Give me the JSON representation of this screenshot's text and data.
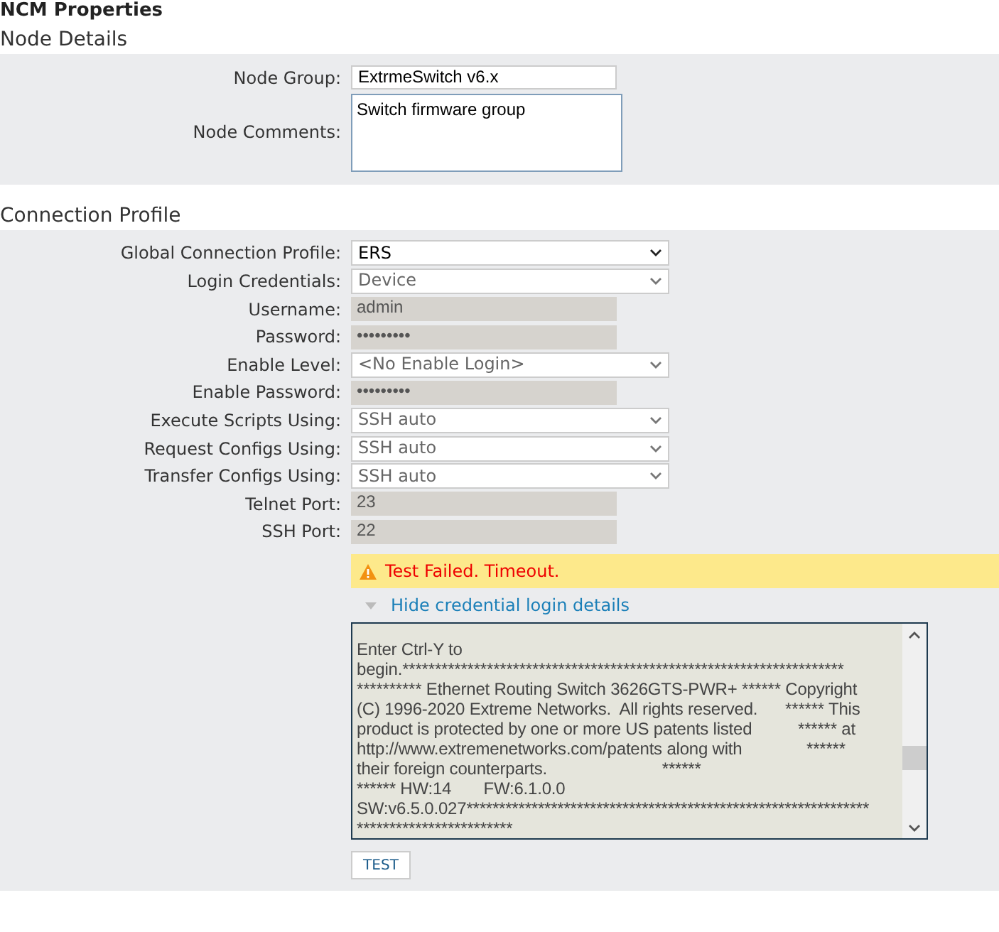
{
  "page_title": "NCM Properties",
  "sections": [
    {
      "title": "Node Details",
      "kind": "details",
      "fields": [
        {
          "label": "Node Group:",
          "kind": "text",
          "value": "ExtrmeSwitch v6.x",
          "disabled": false
        },
        {
          "label": "Node Comments:",
          "kind": "textarea",
          "value": "Switch firmware group"
        }
      ]
    },
    {
      "title": "Connection Profile",
      "kind": "profile",
      "fields": [
        {
          "label": "Global Connection Profile:",
          "kind": "select",
          "value": "ERS",
          "disabled": false
        },
        {
          "label": "Login Credentials:",
          "kind": "select",
          "value": "Device",
          "disabled": true
        },
        {
          "label": "Username:",
          "kind": "text",
          "value": "admin",
          "disabled": true
        },
        {
          "label": "Password:",
          "kind": "text",
          "value": "•••••••••",
          "disabled": true
        },
        {
          "label": "Enable Level:",
          "kind": "select",
          "value": "<No Enable Login>",
          "disabled": true
        },
        {
          "label": "Enable Password:",
          "kind": "text",
          "value": "•••••••••",
          "disabled": true
        },
        {
          "label": "Execute Scripts Using:",
          "kind": "select",
          "value": "SSH auto",
          "disabled": true
        },
        {
          "label": "Request Configs Using:",
          "kind": "select",
          "value": "SSH auto",
          "disabled": true
        },
        {
          "label": "Transfer Configs Using:",
          "kind": "select",
          "value": "SSH auto",
          "disabled": true
        },
        {
          "label": "Telnet Port:",
          "kind": "text",
          "value": "23",
          "disabled": true
        },
        {
          "label": "SSH Port:",
          "kind": "text",
          "value": "22",
          "disabled": true
        }
      ],
      "alert": {
        "message": "Test Failed. Timeout."
      },
      "details_toggle": {
        "label": "Hide credential login details",
        "expanded": true
      },
      "log": [
        "Enter Ctrl-Y to",
        "begin.********************************************************************",
        "********** Ethernet Routing Switch 3626GTS-PWR+ ****** Copyright",
        "(C) 1996-2020 Extreme Networks.  All rights reserved.      ****** This",
        "product is protected by one or more US patents listed          ****** at",
        "http://www.extremenetworks.com/patents along with              ******",
        "their foreign counterparts.                         ******",
        "****** HW:14       FW:6.1.0.0",
        "SW:v6.5.0.027**************************************************************",
        "************************"
      ],
      "test_button": "TEST"
    }
  ]
}
